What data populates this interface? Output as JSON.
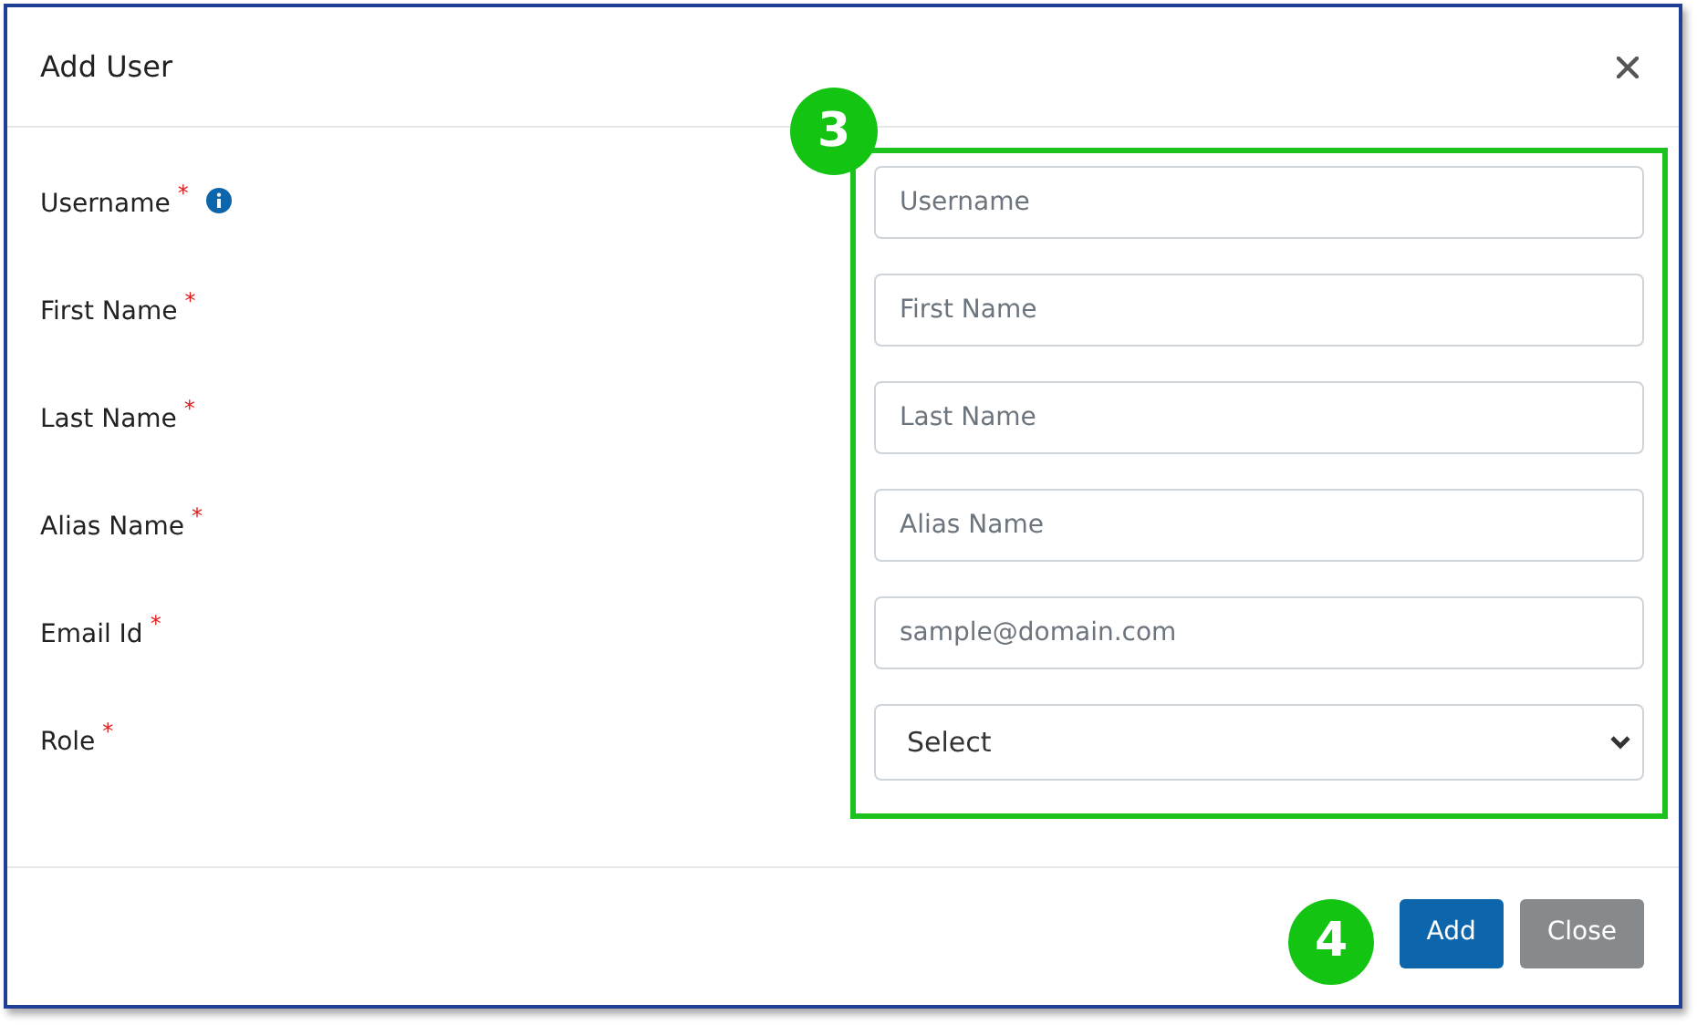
{
  "dialog": {
    "title": "Add User"
  },
  "fields": [
    {
      "kind": "text",
      "label": "Username",
      "required_mark": "*",
      "info": true,
      "placeholder": "Username"
    },
    {
      "kind": "text",
      "label": "First Name",
      "required_mark": "*",
      "info": false,
      "placeholder": "First Name"
    },
    {
      "kind": "text",
      "label": "Last Name",
      "required_mark": "*",
      "info": false,
      "placeholder": "Last Name"
    },
    {
      "kind": "text",
      "label": "Alias Name",
      "required_mark": "*",
      "info": false,
      "placeholder": "Alias Name"
    },
    {
      "kind": "text",
      "label": "Email Id",
      "required_mark": "*",
      "info": false,
      "placeholder": "sample@domain.com"
    },
    {
      "kind": "select",
      "label": "Role",
      "required_mark": "*",
      "info": false,
      "value": "Select"
    }
  ],
  "callouts": [
    "3",
    "4"
  ],
  "buttons": [
    {
      "label": "Add",
      "kind": "primary"
    },
    {
      "label": "Close",
      "kind": "secondary"
    }
  ]
}
